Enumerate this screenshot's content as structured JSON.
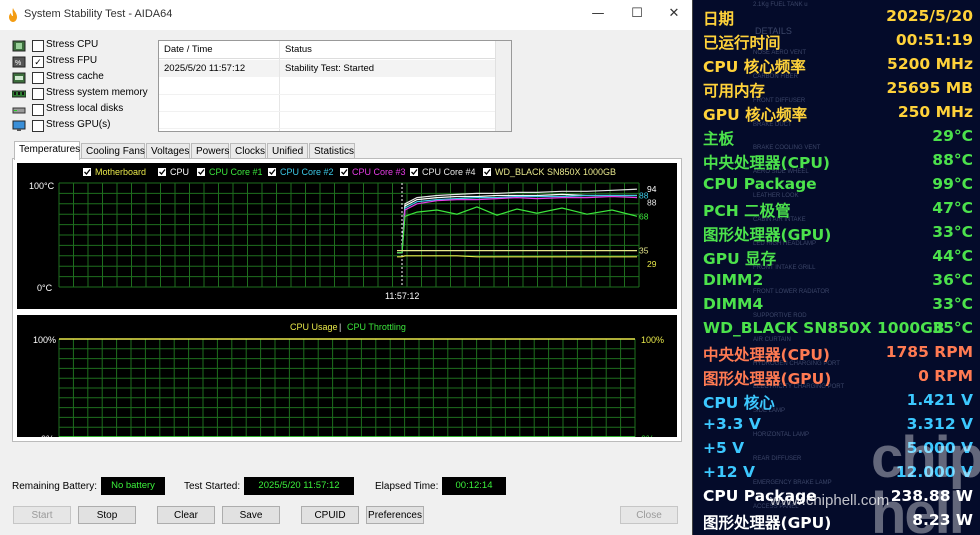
{
  "window": {
    "title": "System Stability Test - AIDA64",
    "controls": {
      "minimize": "—",
      "maximize": "☐",
      "close": "✕"
    }
  },
  "stress_options": [
    {
      "label": "Stress CPU",
      "checked": false,
      "icon": "cpu-chip-icon"
    },
    {
      "label": "Stress FPU",
      "checked": true,
      "icon": "fpu-chip-icon"
    },
    {
      "label": "Stress cache",
      "checked": false,
      "icon": "cache-chip-icon"
    },
    {
      "label": "Stress system memory",
      "checked": false,
      "icon": "memory-module-icon"
    },
    {
      "label": "Stress local disks",
      "checked": false,
      "icon": "disk-drive-icon"
    },
    {
      "label": "Stress GPU(s)",
      "checked": false,
      "icon": "monitor-icon"
    }
  ],
  "log": {
    "col_datetime": "Date / Time",
    "col_status": "Status",
    "rows": [
      {
        "datetime": "2025/5/20 11:57:12",
        "status": "Stability Test: Started"
      }
    ]
  },
  "tabs": [
    "Temperatures",
    "Cooling Fans",
    "Voltages",
    "Powers",
    "Clocks",
    "Unified",
    "Statistics"
  ],
  "active_tab": "Temperatures",
  "chart_data": [
    {
      "type": "line",
      "legend": [
        {
          "name": "Motherboard",
          "color": "#e8e84a",
          "checked": true
        },
        {
          "name": "CPU",
          "color": "#ffffff",
          "checked": true
        },
        {
          "name": "CPU Core #1",
          "color": "#3ce63c",
          "checked": true
        },
        {
          "name": "CPU Core #2",
          "color": "#3cc8e6",
          "checked": true
        },
        {
          "name": "CPU Core #3",
          "color": "#e63ce6",
          "checked": true
        },
        {
          "name": "CPU Core #4",
          "color": "#e6e6e6",
          "checked": true
        },
        {
          "name": "WD_BLACK SN850X 1000GB",
          "color": "#e6e68c",
          "checked": true
        }
      ],
      "ylim": [
        0,
        100
      ],
      "y_top_label": "100°C",
      "y_bottom_label": "0°C",
      "x_marker_label": "11:57:12",
      "right_value_labels": [
        "94",
        "88",
        "88",
        "68",
        "35",
        "29"
      ],
      "series": [
        {
          "name": "CPU Core #4",
          "color": "#e6e6e6",
          "values": [
            33,
            33,
            80,
            86,
            88,
            89,
            90,
            90,
            91,
            91,
            92,
            92,
            93,
            94
          ]
        },
        {
          "name": "CPU",
          "color": "#ffffff",
          "values": [
            33,
            33,
            78,
            84,
            86,
            87,
            87,
            88,
            88,
            88,
            89,
            88,
            88,
            88
          ]
        },
        {
          "name": "CPU Core #2",
          "color": "#3cc8e6",
          "values": [
            33,
            33,
            76,
            82,
            84,
            85,
            86,
            86,
            87,
            87,
            87,
            88,
            88,
            88
          ]
        },
        {
          "name": "CPU Core #3",
          "color": "#e63ce6",
          "values": [
            33,
            33,
            74,
            80,
            83,
            84,
            84,
            85,
            86,
            85,
            86,
            86,
            87,
            86
          ]
        },
        {
          "name": "CPU Core #1",
          "color": "#3ce63c",
          "values": [
            33,
            33,
            68,
            72,
            74,
            70,
            77,
            69,
            75,
            71,
            76,
            70,
            74,
            68
          ]
        },
        {
          "name": "WD_BLACK SN850X 1000GB",
          "color": "#e6e68c",
          "values": [
            35,
            35,
            35,
            35,
            35,
            35,
            35,
            35,
            35,
            35,
            35,
            35,
            35,
            35
          ]
        },
        {
          "name": "Motherboard",
          "color": "#e8e84a",
          "values": [
            29,
            29,
            30,
            30,
            30,
            30,
            29,
            29,
            29,
            29,
            29,
            29,
            29,
            29
          ]
        }
      ]
    },
    {
      "type": "line",
      "legend": [
        {
          "name": "CPU Usage",
          "color": "#e8e84a"
        },
        {
          "name": "CPU Throttling",
          "color": "#3ce63c"
        }
      ],
      "legend_separator": "|",
      "ylim": [
        0,
        100
      ],
      "y_top_label": "100%",
      "y_bottom_label": "0%",
      "right_top_label": "100%",
      "right_bottom_label": "0%",
      "series": [
        {
          "name": "CPU Usage",
          "color": "#e8e84a",
          "values": [
            100,
            100,
            100,
            100,
            100,
            100,
            100,
            100,
            100,
            100,
            100,
            100,
            100,
            100
          ]
        },
        {
          "name": "CPU Throttling",
          "color": "#3ce63c",
          "values": [
            0,
            0,
            0,
            0,
            0,
            0,
            0,
            0,
            0,
            0,
            0,
            0,
            0,
            0
          ]
        }
      ]
    }
  ],
  "status": {
    "battery_label": "Remaining Battery:",
    "battery_value": "No battery",
    "started_label": "Test Started:",
    "started_value": "2025/5/20 11:57:12",
    "elapsed_label": "Elapsed Time:",
    "elapsed_value": "00:12:14"
  },
  "buttons": {
    "start": "Start",
    "stop": "Stop",
    "clear": "Clear",
    "save": "Save",
    "cpuid": "CPUID",
    "preferences": "Preferences",
    "close": "Close"
  },
  "osd": {
    "rows": [
      {
        "key": "日期",
        "value": "2025/5/20",
        "color": "#ffd23a"
      },
      {
        "key": "已运行时间",
        "value": "00:51:19",
        "color": "#ffd23a"
      },
      {
        "key": "CPU 核心频率",
        "value": "5200 MHz",
        "color": "#ffd23a"
      },
      {
        "key": "可用内存",
        "value": "25695 MB",
        "color": "#ffd23a"
      },
      {
        "key": "GPU 核心频率",
        "value": "250 MHz",
        "color": "#ffd23a"
      },
      {
        "key": "主板",
        "value": "29°C",
        "color": "#4ce24c"
      },
      {
        "key": "中央处理器(CPU)",
        "value": "88°C",
        "color": "#4ce24c"
      },
      {
        "key": "CPU Package",
        "value": "99°C",
        "color": "#4ce24c"
      },
      {
        "key": "PCH 二极管",
        "value": "47°C",
        "color": "#4ce24c"
      },
      {
        "key": "图形处理器(GPU)",
        "value": "33°C",
        "color": "#4ce24c"
      },
      {
        "key": "GPU 显存",
        "value": "44°C",
        "color": "#4ce24c"
      },
      {
        "key": "DIMM2",
        "value": "36°C",
        "color": "#4ce24c"
      },
      {
        "key": "DIMM4",
        "value": "33°C",
        "color": "#4ce24c"
      },
      {
        "key": "WD_BLACK SN850X 1000GB",
        "value": "35°C",
        "color": "#4ce24c"
      },
      {
        "key": "中央处理器(CPU)",
        "value": "1785 RPM",
        "color": "#ff7a52"
      },
      {
        "key": "图形处理器(GPU)",
        "value": "0 RPM",
        "color": "#ff7a52"
      },
      {
        "key": "CPU 核心",
        "value": "1.421 V",
        "color": "#3cc8ff"
      },
      {
        "key": "+3.3 V",
        "value": "3.312 V",
        "color": "#3cc8ff"
      },
      {
        "key": "+5 V",
        "value": "5.000 V",
        "color": "#3cc8ff"
      },
      {
        "key": "+12 V",
        "value": "12.000 V",
        "color": "#3cc8ff"
      },
      {
        "key": "CPU Package",
        "value": "238.88 W",
        "color": "#ffffff"
      },
      {
        "key": "图形处理器(GPU)",
        "value": "8.23 W",
        "color": "#ffffff"
      }
    ],
    "background_text": [
      "2.1Kg FUEL TANK u",
      "DETAILS",
      "NOSE AERO VENT",
      "CARBON FIBER",
      "FRONT DIFFUSER",
      "BRAKE DUCT",
      "BRAKE COOLING VENT",
      "AERO SIDE WHEEL",
      "LEATHER LOOK",
      "CABIN AIR INTAKE",
      "LED HIGH HEADLAMP",
      "FRONT INTAKE GRILL",
      "FRONT LOWER RADIATOR",
      "SUPPORTIVE ROD",
      "AIR CURTAIN",
      "HYDROGEN CHARGING PORT",
      "ELECTRICITY CHARGING PORT",
      "SIDE LAMP",
      "HORIZONTAL LAMP",
      "REAR DIFFUSER",
      "EMERGENCY BRAKE LAMP",
      "ACCESS PANEL"
    ],
    "watermark_logo": "chip hell",
    "watermark_site": "www.chiphell.com"
  }
}
